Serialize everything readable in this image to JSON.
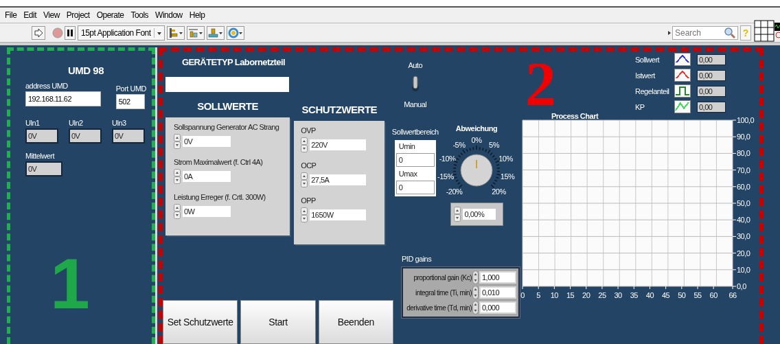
{
  "menu": [
    "File",
    "Edit",
    "View",
    "Project",
    "Operate",
    "Tools",
    "Window",
    "Help"
  ],
  "toolbar": {
    "font": "15pt Application Font",
    "search": {
      "placeholder": "Search"
    },
    "help": "?"
  },
  "umd": {
    "marker": "1",
    "title": "UMD 98",
    "address": {
      "label": "address UMD",
      "value": "192.168.11.62"
    },
    "port": {
      "label": "Port UMD",
      "value": "502"
    },
    "voltages": [
      {
        "label": "Uln1",
        "value": "0V"
      },
      {
        "label": "Uln2",
        "value": "0V"
      },
      {
        "label": "Uln3",
        "value": "0V"
      }
    ],
    "mean": {
      "label": "Mittelwert",
      "value": "0V"
    }
  },
  "device": {
    "title": "GERÄTETYP Labornetzteil"
  },
  "sollwerte": {
    "title": "SOLLWERTE",
    "items": [
      {
        "label": "Sollspannung Generator AC Strang",
        "value": "0V"
      },
      {
        "label": "Strom Maximalwert (f. Ctrl 4A)",
        "value": "0A"
      },
      {
        "label": "Leistung Erreger (f. Crtl. 300W)",
        "value": "0W"
      }
    ]
  },
  "schutzwerte": {
    "title": "SCHUTZWERTE",
    "items": [
      {
        "label": "OVP",
        "value": "220V"
      },
      {
        "label": "OCP",
        "value": "27,5A"
      },
      {
        "label": "OPP",
        "value": "1650W"
      }
    ]
  },
  "mode_switch": {
    "top_label": "Auto",
    "bottom_label": "Manual",
    "on": true
  },
  "sollwertbereich": {
    "title": "Sollwertbereich",
    "fields": [
      {
        "label": "Umin",
        "value": "0"
      },
      {
        "label": "Umax",
        "value": "0"
      }
    ]
  },
  "abweichung": {
    "title": "Abweichung",
    "scale": [
      "-20%",
      "-15%",
      "-10%",
      "-5%",
      "0%",
      "5%",
      "10%",
      "15%",
      "20%"
    ],
    "level": 0.5,
    "value": "0,00%"
  },
  "pid": {
    "title": "PID gains",
    "rows": [
      {
        "label": "proportional gain (Kc)",
        "value": "1,000"
      },
      {
        "label": "integral time (Ti, min)",
        "value": "0,010"
      },
      {
        "label": "derivative time (Td, min)",
        "value": "0,000"
      }
    ]
  },
  "buttons": [
    "Set Schutzwerte",
    "Start",
    "Beenden"
  ],
  "chart": {
    "marker": "2",
    "legend": [
      {
        "name": "Sollwert",
        "color": "#3a3af0",
        "kind": "peak",
        "value": "0,00"
      },
      {
        "name": "Istwert",
        "color": "#f03a3a",
        "kind": "peak",
        "value": "0,00"
      },
      {
        "name": "Regelanteil",
        "color": "#1e8a2a",
        "kind": "pulse",
        "value": "0,00"
      },
      {
        "name": "KP",
        "color": "#3ee05a",
        "kind": "zigzag",
        "value": "0,00"
      }
    ],
    "chart_data": {
      "type": "line",
      "title": "Process Chart",
      "grid": true,
      "xlim": [
        0,
        66
      ],
      "ylim": [
        0,
        100
      ],
      "xticks": [
        0,
        5,
        10,
        15,
        20,
        25,
        30,
        35,
        40,
        45,
        50,
        55,
        60,
        66
      ],
      "yticks": [
        {
          "value": 0,
          "label": "0,0"
        },
        {
          "value": 10,
          "label": "10,0"
        },
        {
          "value": 20,
          "label": "20,0"
        },
        {
          "value": 30,
          "label": "30,0"
        },
        {
          "value": 40,
          "label": "40,0"
        },
        {
          "value": 50,
          "label": "50,0"
        },
        {
          "value": 60,
          "label": "60,0"
        },
        {
          "value": 70,
          "label": "70,0"
        },
        {
          "value": 80,
          "label": "80,0"
        },
        {
          "value": 90,
          "label": "90,0"
        },
        {
          "value": 100,
          "label": "100,0"
        }
      ]
    }
  }
}
